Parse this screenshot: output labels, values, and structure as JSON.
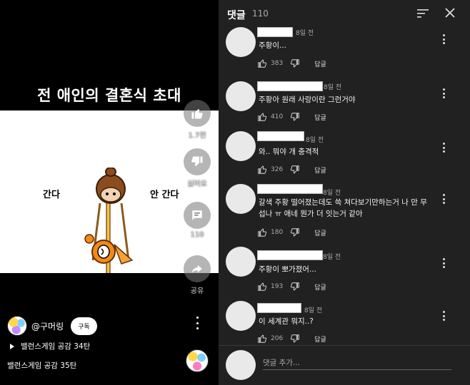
{
  "video": {
    "title": "전 애인의 결혼식 초대",
    "choice_left": "간다",
    "choice_right": "안 간다",
    "actions": [
      {
        "icon": "thumbs-up-icon",
        "label": "1.7천"
      },
      {
        "icon": "thumbs-down-icon",
        "label": "싫어요"
      },
      {
        "icon": "comment-icon",
        "label": "110"
      },
      {
        "icon": "share-icon",
        "label": "공유"
      }
    ],
    "channel": "@구머링",
    "subscribe": "구독",
    "playlist": "밸런스게임 공감 34탄",
    "next_title": "밸런스게임 공감 35탄"
  },
  "comments_panel": {
    "title": "댓글",
    "count": "110",
    "add_placeholder": "댓글 추가...",
    "reply_label": "답글",
    "comments": [
      {
        "time": "8일 전",
        "text": "주황이...",
        "likes": "383"
      },
      {
        "time": "8일 전",
        "text": "주황아 원래 사랑이란 그런거야",
        "likes": "410"
      },
      {
        "time": "8일 전",
        "text": "와.. 뭐야 개 충격적",
        "likes": "326"
      },
      {
        "time": "8일 전",
        "text": "갈색 주황 떨어졌는데도 쓱 쳐다보기만하는거 나 만 무섭나 ㅠ 애네 뭔가 더 잇는거 같아",
        "likes": "180"
      },
      {
        "time": "8일 전",
        "text": "주황이 뽀가졌어...",
        "likes": "193"
      },
      {
        "time": "8일 전",
        "text": "이 세계관 뭐지..?",
        "likes": "206"
      }
    ]
  },
  "colors": {
    "panel_bg": "#212121",
    "muted_text": "#aaaaaa"
  }
}
